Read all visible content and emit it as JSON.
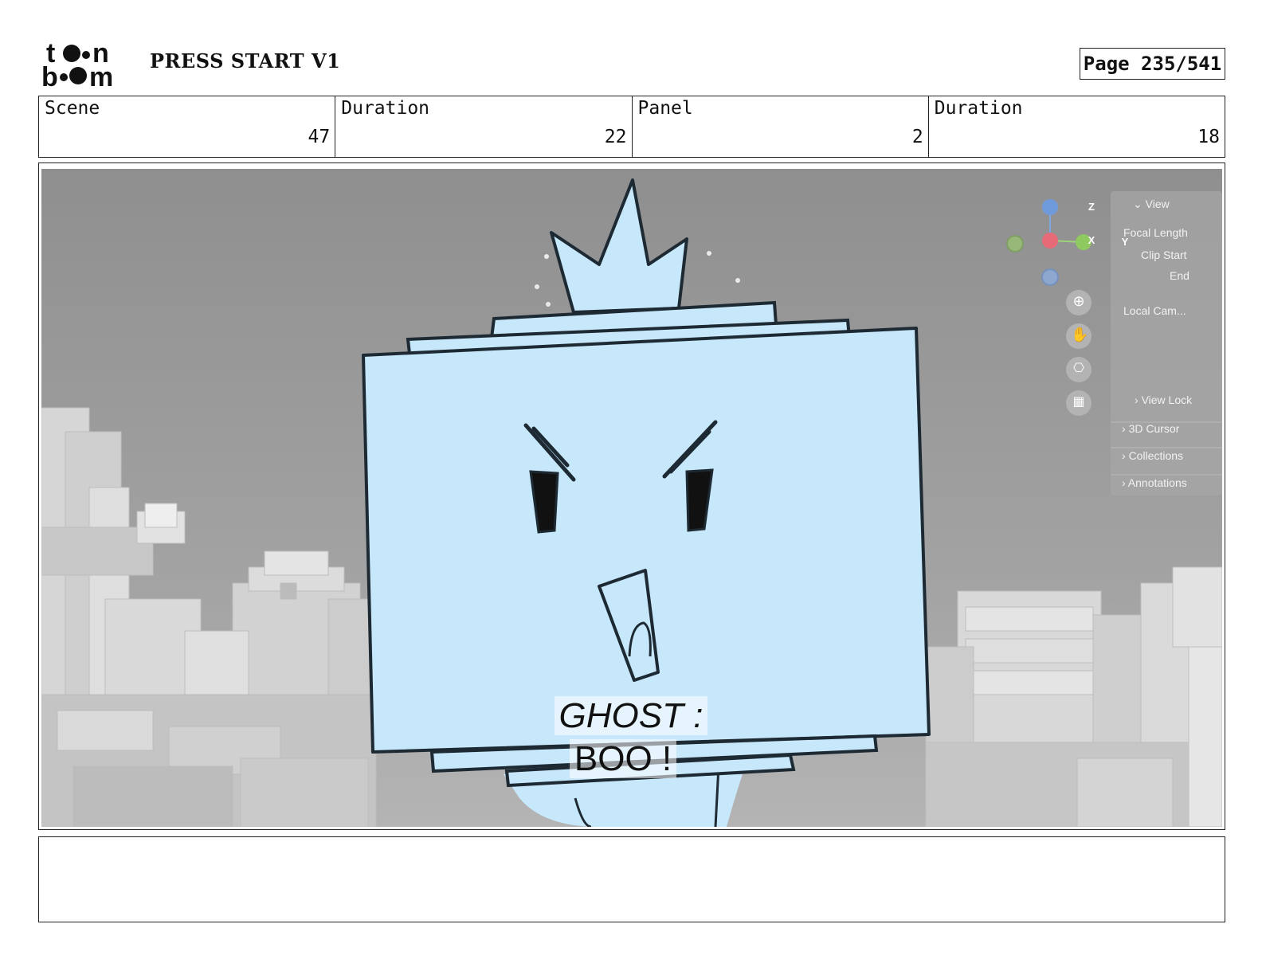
{
  "header": {
    "logo_text": "toon boom",
    "project_title": "PRESS START V1",
    "page_label": "Page 235/541"
  },
  "info": [
    {
      "label": "Scene",
      "value": "47"
    },
    {
      "label": "Duration",
      "value": "22"
    },
    {
      "label": "Panel",
      "value": "2"
    },
    {
      "label": "Duration",
      "value": "18"
    }
  ],
  "panel": {
    "dialog_line1": "GHOST :",
    "dialog_line2": "BOO !",
    "viewport_panel": {
      "header": "View",
      "focal_length": "Focal Length",
      "clip_start": "Clip Start",
      "end": "End",
      "local_camera": "Local Cam...",
      "view_lock": "View Lock",
      "cursor_3d": "3D Cursor",
      "collections": "Collections",
      "annotations": "Annotations"
    },
    "gizmo": {
      "z": "Z",
      "x": "X",
      "y": "Y"
    }
  },
  "colors": {
    "ghost_fill": "#c7e8fb",
    "scene_bg": "#9a9a9a",
    "outline": "#1e2a33"
  },
  "icons": [
    "zoom-icon",
    "hand-icon",
    "camera-icon",
    "grid-icon"
  ]
}
